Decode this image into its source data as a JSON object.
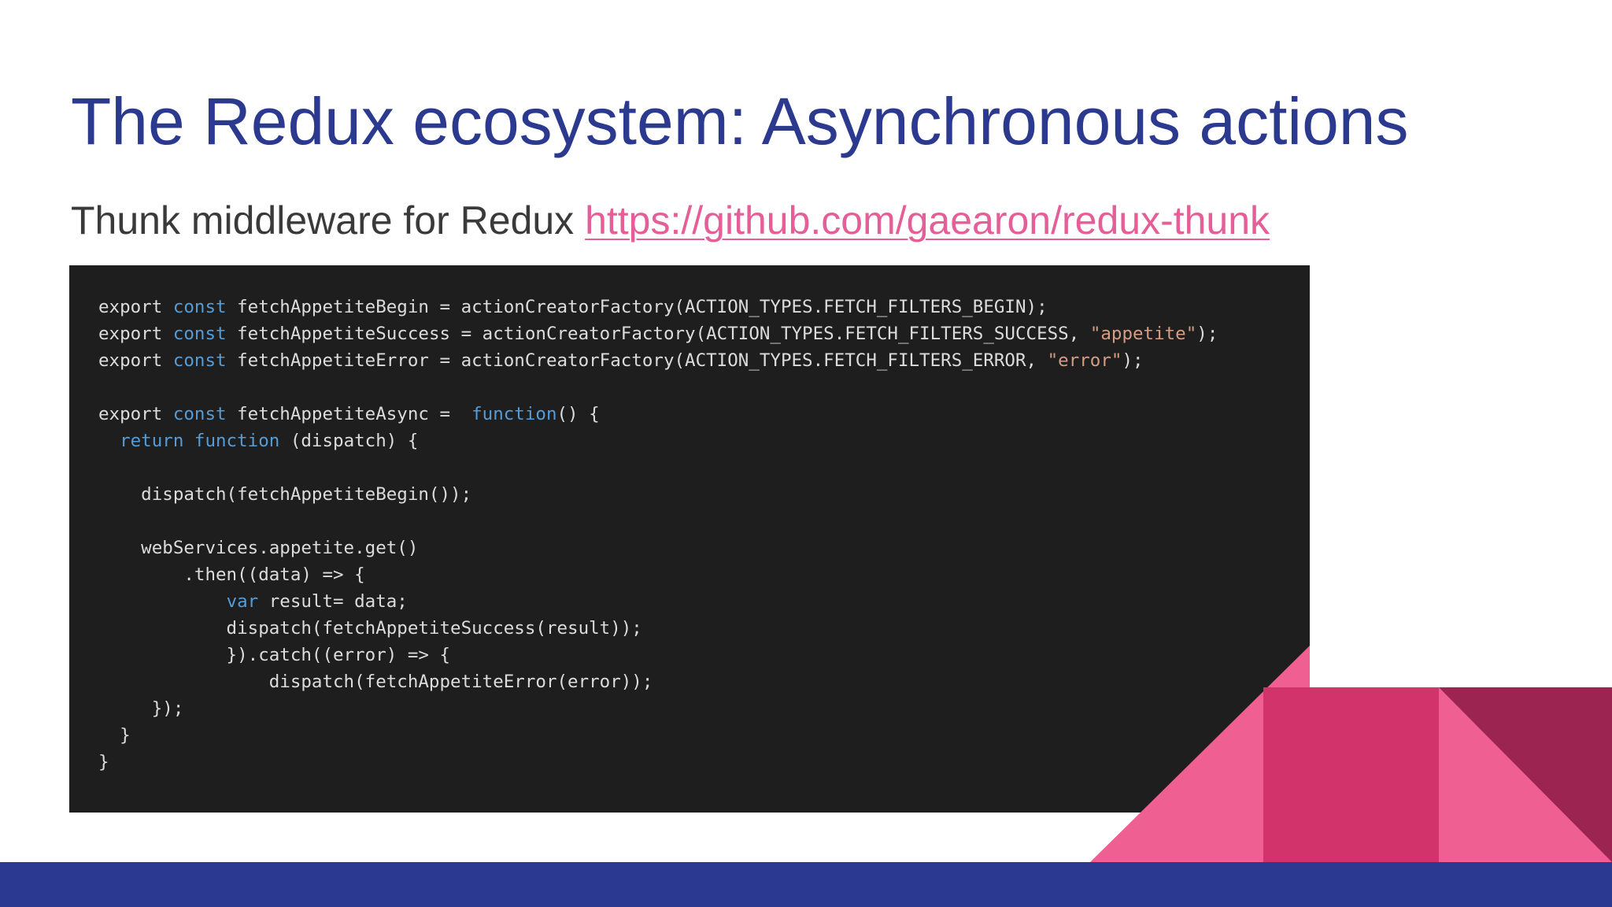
{
  "slide": {
    "title": "The Redux ecosystem: Asynchronous actions",
    "subtitle_text": "Thunk middleware for Redux ",
    "subtitle_link": "https://github.com/gaearon/redux-thunk"
  },
  "code_lines": [
    [
      {
        "t": "export "
      },
      {
        "t": "const",
        "k": "kw"
      },
      {
        "t": " fetchAppetiteBegin = actionCreatorFactory(ACTION_TYPES.FETCH_FILTERS_BEGIN);"
      }
    ],
    [
      {
        "t": "export "
      },
      {
        "t": "const",
        "k": "kw"
      },
      {
        "t": " fetchAppetiteSuccess = actionCreatorFactory(ACTION_TYPES.FETCH_FILTERS_SUCCESS, "
      },
      {
        "t": "\"appetite\"",
        "k": "str"
      },
      {
        "t": ");"
      }
    ],
    [
      {
        "t": "export "
      },
      {
        "t": "const",
        "k": "kw"
      },
      {
        "t": " fetchAppetiteError = actionCreatorFactory(ACTION_TYPES.FETCH_FILTERS_ERROR, "
      },
      {
        "t": "\"error\"",
        "k": "str"
      },
      {
        "t": ");"
      }
    ],
    [],
    [
      {
        "t": "export "
      },
      {
        "t": "const",
        "k": "kw"
      },
      {
        "t": " fetchAppetiteAsync =  "
      },
      {
        "t": "function",
        "k": "kw"
      },
      {
        "t": "() {"
      }
    ],
    [
      {
        "t": "  "
      },
      {
        "t": "return",
        "k": "kw"
      },
      {
        "t": " "
      },
      {
        "t": "function",
        "k": "kw"
      },
      {
        "t": " (dispatch) {"
      }
    ],
    [],
    [
      {
        "t": "    dispatch(fetchAppetiteBegin());"
      }
    ],
    [],
    [
      {
        "t": "    webServices.appetite.get()"
      }
    ],
    [
      {
        "t": "        .then((data) => {"
      }
    ],
    [
      {
        "t": "            "
      },
      {
        "t": "var",
        "k": "kw"
      },
      {
        "t": " result= data;"
      }
    ],
    [
      {
        "t": "            dispatch(fetchAppetiteSuccess(result));"
      }
    ],
    [
      {
        "t": "            }).catch((error) => {"
      }
    ],
    [
      {
        "t": "                dispatch(fetchAppetiteError(error));"
      }
    ],
    [
      {
        "t": "     });"
      }
    ],
    [
      {
        "t": "  }"
      }
    ],
    [
      {
        "t": "}"
      }
    ]
  ],
  "colors": {
    "title": "#2b3a8e",
    "link": "#e45e97",
    "code_bg": "#1e1e1e",
    "keyword": "#569cd6",
    "string": "#d69d85",
    "bottom_bar": "#2b3990",
    "deco_pink": "#ef5f92",
    "deco_magenta": "#d3336b",
    "deco_dark": "#9c2450"
  }
}
